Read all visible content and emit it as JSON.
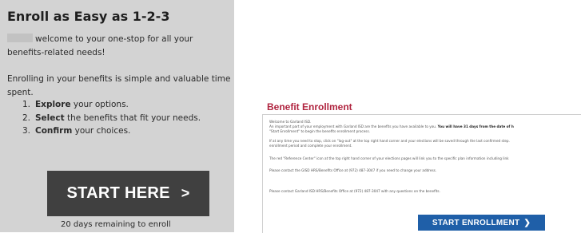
{
  "left_panel": {
    "title": "Enroll as Easy as 1-2-3",
    "welcome": "welcome to your one-stop for all your benefits-related needs!",
    "intro": "Enrolling in your benefits is simple and valuable time spent.",
    "steps": [
      {
        "num": "1.",
        "bold": "Explore",
        "rest": " your options."
      },
      {
        "num": "2.",
        "bold": "Select",
        "rest": " the benefits that fit your needs."
      },
      {
        "num": "3.",
        "bold": "Confirm",
        "rest": " your choices."
      }
    ],
    "start_label": "START HERE",
    "start_arrow": ">",
    "remaining": "20 days remaining to enroll"
  },
  "right_panel": {
    "title": "Benefit Enrollment",
    "welcome": "Welcome to Garland ISD.",
    "para1_normal": "An important part of your employment with Garland ISD are the benefits you have available to you. ",
    "para1_bold": "You will have 31 days from the date of h",
    "para1_line2": "\"Start Enrollment\" to begin the benefits enrollment process.",
    "para2_line1": "If at any time you need to stop, click on \"log-out\" at the top right hand corner and your elections will be saved through the last confirmed step.",
    "para2_line2": "enrollment period and complete your enrollment.",
    "para3": "The red \"Reference Center\" icon at the top right hand corner of your elections pages will link you to the specific plan information including link",
    "para4": "Please contact the GISD HRS/Benefits Office at (972) 487-3047 if you need to change your address.",
    "para5": "Please contact Garland ISD HRS/Benefits Office at (972) 487-3047 with any questions on the benefits.",
    "button_label": "START ENROLLMENT",
    "button_arrow": "❯"
  },
  "colors": {
    "left_bg": "#d3d3d3",
    "start_here_bg": "#404040",
    "title_red": "#b0243f",
    "enroll_blue": "#1f5fa8"
  }
}
